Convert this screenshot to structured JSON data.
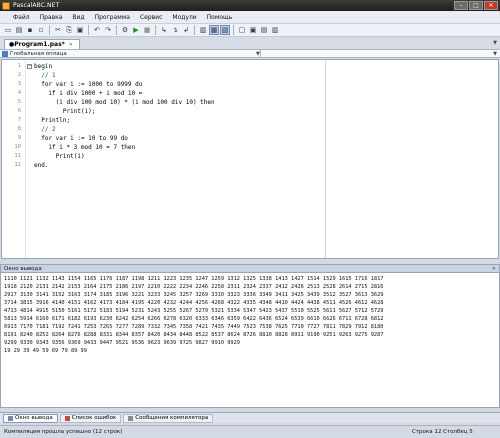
{
  "window": {
    "title": "PascalABC.NET",
    "buttons": [
      "–",
      "□",
      "✕"
    ]
  },
  "menu": [
    "Файл",
    "Правка",
    "Вид",
    "Программа",
    "Сервис",
    "Модули",
    "Помощь"
  ],
  "toolbar": {
    "icons": [
      "new-file-icon",
      "open-icon",
      "save-icon",
      "save-all-icon",
      "cut-icon",
      "copy-icon",
      "paste-icon",
      "undo-icon",
      "redo-icon",
      "compile-icon",
      "run-icon",
      "stop-icon",
      "step-icon",
      "step-into-icon",
      "step-over-icon",
      "editor-view-icon",
      "split-view-icon",
      "output-view-icon",
      "window-a-icon",
      "window-b-icon",
      "window-c-icon",
      "window-d-icon"
    ],
    "glyphs": [
      "▭",
      "▤",
      "▪",
      "▫",
      "✂",
      "⎘",
      "▣",
      "↶",
      "↷",
      "⚙",
      "▶",
      "■",
      "↳",
      "↴",
      "↲",
      "▥",
      "▦",
      "▧",
      "▢",
      "▣",
      "▤",
      "▥"
    ]
  },
  "editor_tab": {
    "label": "●Program1.pas*",
    "close": "✕",
    "dropdown": "▼"
  },
  "scope": {
    "left": "Глобальная оплаца",
    "arrow": "▼"
  },
  "code": {
    "lines": [
      "begin",
      "  // 1",
      "  for var i := 1000 to 9999 do",
      "    if i div 1000 + i mod 10 =",
      "      (i div 100 mod 10) * (i mod 100 div 10) then",
      "        Print(i);",
      "  Println;",
      "  // 2",
      "  for var i := 10 to 99 do",
      "    if i * 3 mod 10 = 7 then",
      "      Print(i)",
      "end."
    ],
    "line_numbers": [
      "1",
      "2",
      "3",
      "4",
      "5",
      "6",
      "7",
      "8",
      "9",
      "10",
      "11",
      "12"
    ]
  },
  "output": {
    "header": "Окно вывода",
    "pin": "✕",
    "lines": [
      "1110 1121 1132 1143 1154 1165 1176 1187 1198 1211 1223 1235 1247 1259 1312 1325 1338 1413 1427 1514 1529 1615 1716 1817",
      "1918 2120 2131 2142 2153 2164 2175 2186 2197 2210 2222 2234 2246 2258 2311 2324 2337 2412 2426 2513 2528 2614 2715 2816",
      "2917 3130 3141 3152 3163 3174 3185 3196 3221 3233 3245 3257 3269 3310 3323 3336 3349 3411 3425 3439 3512 3527 3613 3629",
      "3714 3815 3916 4140 4151 4162 4173 4184 4195 4220 4232 4244 4256 4268 4322 4335 4348 4410 4424 4438 4511 4526 4612 4628",
      "4713 4814 4915 5150 5161 5172 5183 5194 5231 5243 5255 5267 5279 5321 5334 5347 5423 5437 5510 5525 5611 5627 5712 5729",
      "5813 5914 6160 6171 6182 6193 6230 6242 6254 6266 6278 6320 6333 6346 6359 6422 6436 6524 6539 6610 6626 6711 6728 6812",
      "6913 7170 7181 7192 7241 7253 7265 7277 7289 7332 7345 7358 7421 7435 7449 7523 7538 7625 7710 7727 7811 7829 7912 8180",
      "8191 8240 8252 8264 8276 8288 8331 8344 8357 8420 8434 8448 8522 8537 8624 8726 8810 8828 8911 9190 9251 9263 9275 9287",
      "9299 9330 9343 9356 9369 9433 9447 9521 9536 9623 9639 9725 9827 9910 9929",
      "19 29 39 49 59 69 79 89 99"
    ]
  },
  "bottom_tabs": [
    "Окно вывода",
    "Список ошибок",
    "Сообщения компилятора"
  ],
  "status": {
    "message": "Компиляция прошла успешно (12 строк)",
    "position": "Строка  12  Столбец  5"
  }
}
